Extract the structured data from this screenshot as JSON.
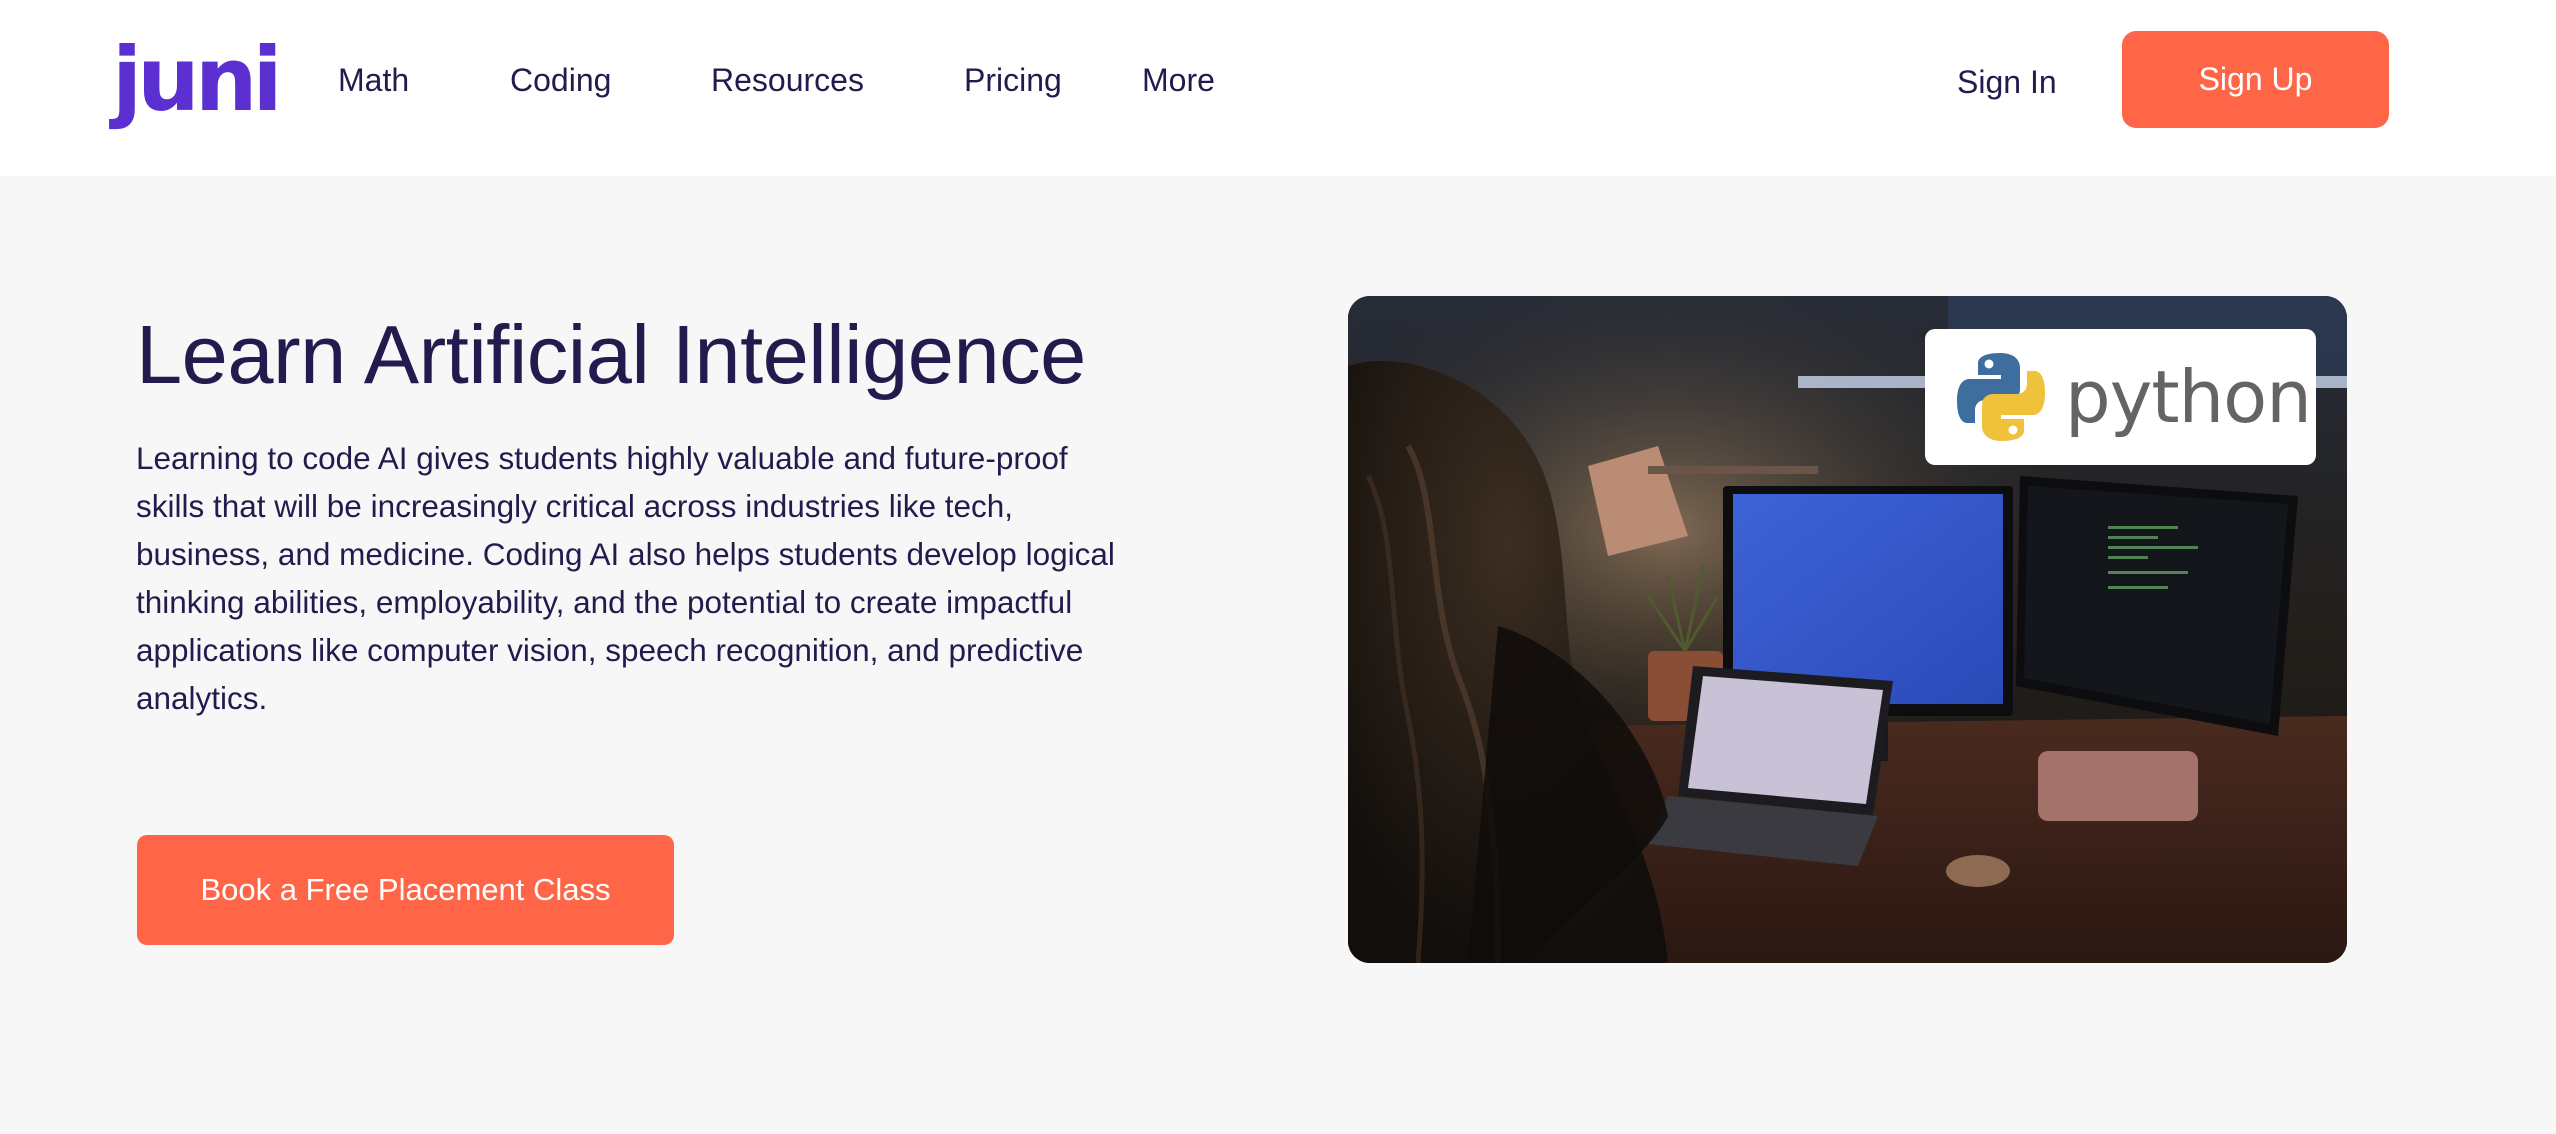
{
  "brand": {
    "logo_text": "juni",
    "logo_color": "#5b2fd0",
    "accent": "#ff6648",
    "text_color": "#231b4e"
  },
  "nav": {
    "links": [
      "Math",
      "Coding",
      "Resources",
      "Pricing",
      "More"
    ],
    "sign_in": "Sign In",
    "sign_up": "Sign Up"
  },
  "hero": {
    "title": "Learn Artificial Intelligence",
    "description": "Learning to code AI gives students highly valuable and future-proof skills that will be increasingly critical across industries like tech, business, and medicine. Coding AI also helps students develop logical thinking abilities, employability, and the potential to create impactful applications like computer vision, speech recognition, and predictive analytics.",
    "cta": "Book a Free Placement Class",
    "image_badge_text": "python",
    "image_badge_icon": "python-logo-icon"
  }
}
